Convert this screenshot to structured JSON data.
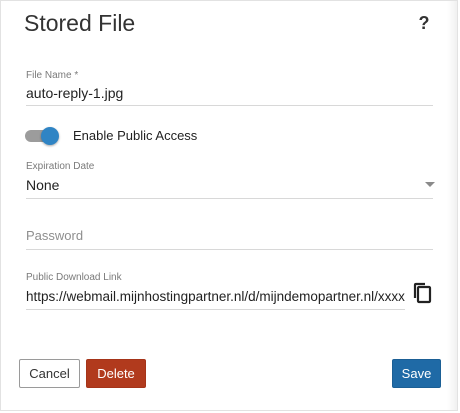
{
  "dialog": {
    "title": "Stored File",
    "help_label": "?"
  },
  "file_name": {
    "label": "File Name *",
    "value": "auto-reply-1.jpg"
  },
  "public_access": {
    "label": "Enable Public Access",
    "enabled": true,
    "accent_color": "#2f84c4"
  },
  "expiration": {
    "label": "Expiration Date",
    "selected": "None"
  },
  "password": {
    "placeholder": "Password"
  },
  "download_link": {
    "label": "Public Download Link",
    "value": "https://webmail.mijnhostingpartner.nl/d/mijndemopartner.nl/xxxxxxxx",
    "copy_icon": "copy-icon"
  },
  "actions": {
    "cancel_label": "Cancel",
    "delete_label": "Delete",
    "save_label": "Save",
    "delete_color": "#b13a1d",
    "save_color": "#1f6aa6"
  }
}
